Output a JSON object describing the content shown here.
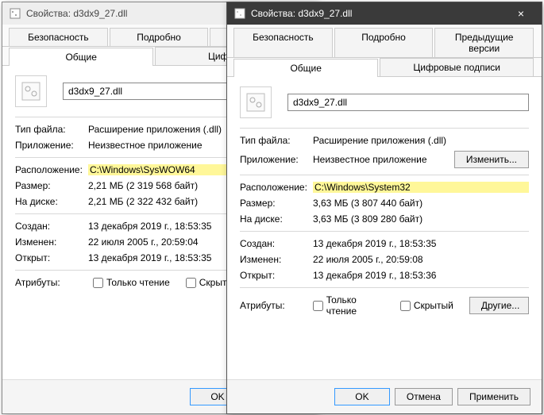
{
  "title_prefix": "Свойства: ",
  "close_glyph": "×",
  "tabs": {
    "security": "Безопасность",
    "details": "Подробно",
    "previous": "Предыдущие версии",
    "previous_clip": "Пре",
    "general": "Общие",
    "signatures": "Цифровые подписи",
    "signatures_clip": "Цифровые"
  },
  "labels": {
    "filetype": "Тип файла:",
    "app": "Приложение:",
    "change_btn": "Изменить...",
    "location": "Расположение:",
    "size": "Размер:",
    "ondisk": "На диске:",
    "created": "Создан:",
    "modified": "Изменен:",
    "accessed": "Открыт:",
    "attributes": "Атрибуты:",
    "readonly": "Только чтение",
    "hidden": "Скрытый",
    "other_btn": "Другие...",
    "ok": "OK",
    "cancel": "Отмена",
    "cancel_clip": "Отмен",
    "apply": "Применить"
  },
  "back": {
    "filename": "d3dx9_27.dll",
    "filetype": "Расширение приложения (.dll)",
    "app": "Неизвестное приложение",
    "location": "C:\\Windows\\SysWOW64",
    "size": "2,21 МБ (2 319 568 байт)",
    "ondisk": "2,21 МБ (2 322 432 байт)",
    "created": "13 декабря 2019 г., 18:53:35",
    "modified": "22 июля 2005 г., 20:59:04",
    "accessed": "13 декабря 2019 г., 18:53:35"
  },
  "front": {
    "filename": "d3dx9_27.dll",
    "filetype": "Расширение приложения (.dll)",
    "app": "Неизвестное приложение",
    "location": "C:\\Windows\\System32",
    "size": "3,63 МБ (3 807 440 байт)",
    "ondisk": "3,63 МБ (3 809 280 байт)",
    "created": "13 декабря 2019 г., 18:53:35",
    "modified": "22 июля 2005 г., 20:59:08",
    "accessed": "13 декабря 2019 г., 18:53:36"
  }
}
